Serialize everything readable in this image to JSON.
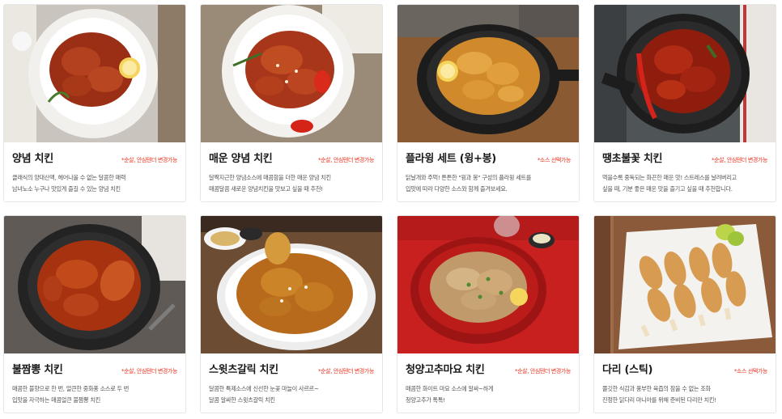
{
  "menu": {
    "items": [
      {
        "name": "양념 치킨",
        "badge": "*순살, 안심텐더 변경가능",
        "desc_lines": [
          "클래식의 양대산맥, 헤어나올 수 없는 달콤한 매력",
          "남녀노소 누구나 맛있게 즐길 수 있는 양념 치킨"
        ]
      },
      {
        "name": "매운 양념 치킨",
        "badge": "*순살, 안심텐더 변경가능",
        "desc_lines": [
          "달짝지근한 양념소스에 매콤함을 더한 매운 양념 치킨",
          "매콤달콤 새로운 양념치킨을 맛보고 싶을 때 추천!"
        ]
      },
      {
        "name": "플라윙 세트 (윙+봉)",
        "badge": "*소스 선택가능",
        "desc_lines": [
          "닭날개와 주먹! 튼튼한 \"윙과 봉\" 구성의 플라윙 세트를",
          "입맛에 따라 다양한 소스와 함께 즐겨보세요."
        ]
      },
      {
        "name": "땡초불꽃 치킨",
        "badge": "*순살, 안심텐더 변경가능",
        "desc_lines": [
          "먹을수록 중독되는 화끈한 매운 맛! 스트레스를 날려버리고",
          "싶을 때, 기분 좋은 매운 맛을 즐기고 싶을 때 추천합니다."
        ]
      },
      {
        "name": "불짬뽕 치킨",
        "badge": "*순살, 안심텐더 변경가능",
        "desc_lines": [
          "매콤한 불향으로 한 번, 얼큰한 중화풍 소스로 두 번",
          "입맛을 자극하는 매콤얼큰 불짬뽕 치킨"
        ]
      },
      {
        "name": "스윗츠갈릭 치킨",
        "badge": "*순살, 안심텐더 변경가능",
        "desc_lines": [
          "달콤한 특제소스에 신선한 눈꽃 마늘이 사르르~",
          "달콤 알싸한 스윗츠갈릭 치킨"
        ]
      },
      {
        "name": "청양고추마요 치킨",
        "badge": "*순살, 안심텐더 변경가능",
        "desc_lines": [
          "매콤한 화이트 마요 소스에 알싸~하게",
          "청양고추가 톡톡!"
        ]
      },
      {
        "name": "다리 (스틱)",
        "badge": "*소스 선택가능",
        "desc_lines": [
          "쫄깃한 식감과 풍부한 육즙의 참을 수 없는 조화",
          "진정한 닭다리 마니아를 위해 준비된 다리만 치킨!"
        ]
      }
    ]
  },
  "colors": {
    "badge": "#e8321e",
    "title": "#1a1a1a",
    "desc": "#555555",
    "card_border": "#e6e6e6"
  },
  "photos": [
    "sauced-chicken-on-white-plate-lace",
    "spicy-sauced-chicken-white-plate",
    "fried-wings-in-black-skillet",
    "red-hot-chicken-black-skillet",
    "jjamppong-chicken-black-plate",
    "sweet-garlic-chicken-white-plate",
    "mayo-chicken-red-plate",
    "fried-drumsticks-on-board"
  ]
}
